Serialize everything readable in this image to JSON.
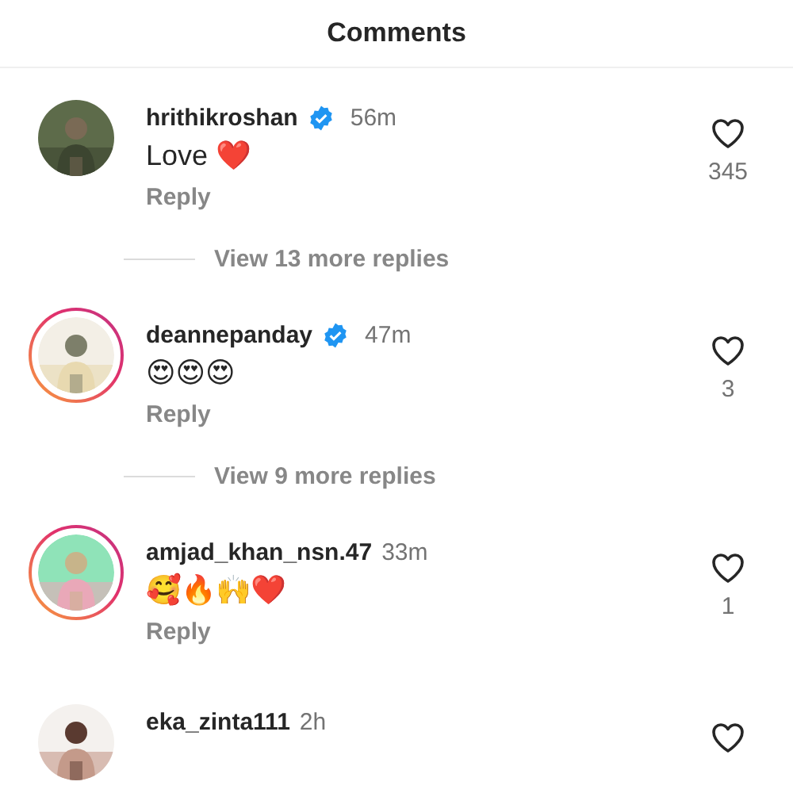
{
  "header": {
    "title": "Comments"
  },
  "comments": [
    {
      "username": "hrithikroshan",
      "verified": true,
      "time": "56m",
      "text": "Love ❤️",
      "reply": "Reply",
      "likes": "345",
      "story_ring": false,
      "view_replies": "View 13 more replies"
    },
    {
      "username": "deannepanday",
      "verified": true,
      "time": "47m",
      "text": "😍😍😍",
      "reply": "Reply",
      "likes": "3",
      "story_ring": true,
      "view_replies": "View 9 more replies"
    },
    {
      "username": "amjad_khan_nsn.47",
      "verified": false,
      "time": "33m",
      "text": "🥰🔥🙌❤️",
      "reply": "Reply",
      "likes": "1",
      "story_ring": true
    },
    {
      "username": "eka_zinta111",
      "verified": false,
      "time": "2h",
      "story_ring": false
    }
  ]
}
